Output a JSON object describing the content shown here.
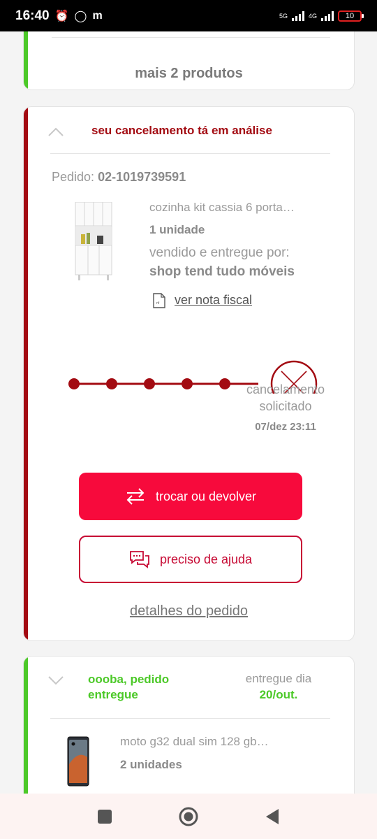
{
  "status_bar": {
    "time": "16:40",
    "network_left": "5G",
    "network_right": "4G",
    "battery": "10"
  },
  "cards": [
    {
      "more_products": "mais 2 produtos"
    },
    {
      "status": "seu cancelamento tá em análise",
      "order_label": "Pedido:",
      "order_number": "02-1019739591",
      "product_name": "cozinha kit cassia 6 porta…",
      "quantity": "1 unidade",
      "sold_by_label": "vendido e entregue por:",
      "seller": "shop tend tudo móveis",
      "invoice_link": "ver nota fiscal",
      "tracking": {
        "cancel_label": "cancelamento solicitado",
        "cancel_date": "07/dez 23:11",
        "color": "#a30b12"
      },
      "primary_button": "trocar ou devolver",
      "secondary_button": "preciso de ajuda",
      "details_link": "detalhes do pedido"
    },
    {
      "status": "oooba, pedido entregue",
      "delivered_label": "entregue dia",
      "delivered_date": "20/out.",
      "product_name": "moto g32 dual sim 128 gb…",
      "quantity": "2 unidades"
    }
  ],
  "colors": {
    "accent_red": "#f70a3c",
    "cancel_red": "#a30b12",
    "success_green": "#4cc928"
  },
  "nav": {
    "icons": [
      "square-icon",
      "home-circle-icon",
      "back-triangle-icon"
    ]
  }
}
